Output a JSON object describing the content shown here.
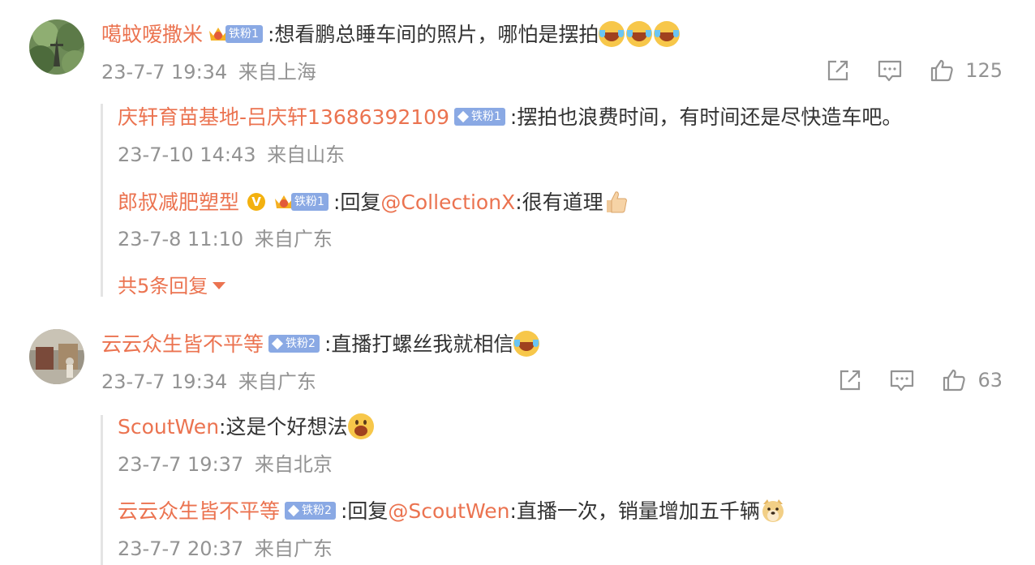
{
  "comments": [
    {
      "user": "噶蚊嗳撒米",
      "badge": "铁粉1",
      "separator": ":",
      "text": "想看鹏总睡车间的照片，哪怕是摆拍",
      "time": "23-7-7 19:34",
      "location": "来自上海",
      "likes": "125",
      "replies": [
        {
          "user": "庆轩育苗基地-吕庆轩13686392109",
          "badge": "铁粉1",
          "separator": ":",
          "text": "摆拍也浪费时间，有时间还是尽快造车吧。",
          "time": "23-7-10 14:43",
          "location": "来自山东"
        },
        {
          "user": "郎叔减肥塑型",
          "verified": "V",
          "badge": "铁粉1",
          "separator": ":",
          "prefix": "回复",
          "mention": "@CollectionX",
          "separator2": ":",
          "text": "很有道理",
          "time": "23-7-8 11:10",
          "location": "来自广东"
        }
      ],
      "more_replies": "共5条回复"
    },
    {
      "user": "云云众生皆不平等",
      "badge": "铁粉2",
      "separator": ":",
      "text": "直播打螺丝我就相信",
      "time": "23-7-7 19:34",
      "location": "来自广东",
      "likes": "63",
      "replies": [
        {
          "user": "ScoutWen",
          "separator": ":",
          "text": "这是个好想法",
          "time": "23-7-7 19:37",
          "location": "来自北京"
        },
        {
          "user": "云云众生皆不平等",
          "badge": "铁粉2",
          "separator": ":",
          "prefix": "回复",
          "mention": "@ScoutWen",
          "separator2": ":",
          "text": "直播一次，销量增加五千辆",
          "time": "23-7-7 20:37",
          "location": "来自广东"
        }
      ]
    }
  ],
  "colors": {
    "name": "#eb7350",
    "text": "#333333",
    "meta": "#939393",
    "badge": "#8aa9e4",
    "reply_border": "#e4e4e4"
  },
  "icons": {
    "share": "share-icon",
    "comment": "comment-icon",
    "like": "like-icon",
    "emoji_laugh": "laugh-emoji-icon",
    "emoji_thumb": "thumbs-up-emoji-icon",
    "emoji_grin": "grin-emoji-icon",
    "emoji_dog": "doge-emoji-icon",
    "crown": "crown-icon",
    "expand": "caret-down-icon"
  }
}
